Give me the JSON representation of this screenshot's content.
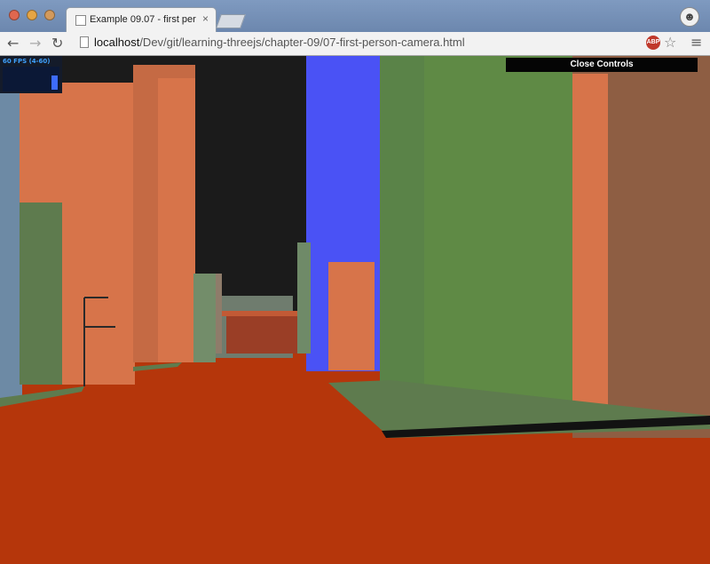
{
  "window": {
    "tab_title": "Example 09.07 - first per",
    "tab_close": "×",
    "url_host": "localhost",
    "url_path": "/Dev/git/learning-threejs/chapter-09/07-first-person-camera.html",
    "profile_icon": "incognito-avatar-icon"
  },
  "toolbar": {
    "back_icon": "←",
    "forward_icon": "→",
    "reload_icon": "↻",
    "adblock_label": "ABP",
    "star_icon": "☆",
    "menu_icon": "≡"
  },
  "stats": {
    "label": "60 FPS (4-60)",
    "fps": 60
  },
  "controls": {
    "close_label": "Close Controls"
  },
  "colors": {
    "ground": "#b5360b",
    "orange_building": "#d7744a",
    "green_building": "#5f8a45",
    "blue_building": "#4a52f5",
    "sky": "#1b1b1b"
  }
}
